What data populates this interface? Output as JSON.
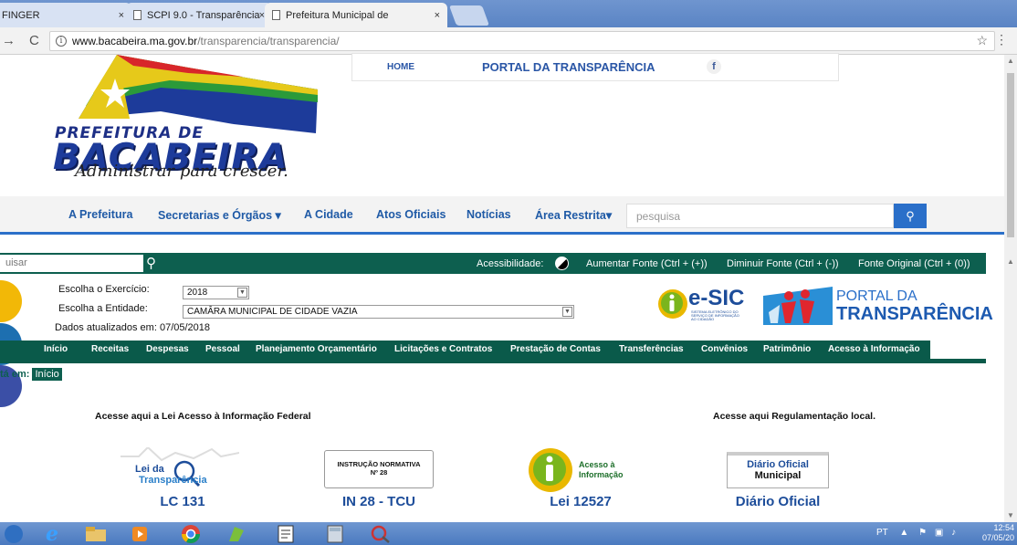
{
  "browser": {
    "tabs": [
      {
        "label": "FINGER",
        "close": "×"
      },
      {
        "label": "SCPI 9.0 - Transparência",
        "close": "×"
      },
      {
        "label": "Prefeitura Municipal de ",
        "close": "×"
      }
    ],
    "url_host": "www.bacabeira.ma.gov.br",
    "url_path": "/transparencia/transparencia/",
    "info_glyph": "i"
  },
  "header": {
    "logo_title_1": "PREFEITURA DE",
    "logo_title_2": "BACABEIRA",
    "slogan": "Administrar para crescer.",
    "top_menu": {
      "home": "HOME",
      "portal": "PORTAL DA TRANSPARÊNCIA",
      "facebook": "f"
    }
  },
  "main_nav": {
    "items": [
      "A Prefeitura",
      "Secretarias e Órgãos ▾",
      "A Cidade",
      "Atos Oficiais",
      "Notícias",
      "Área Restrita▾"
    ],
    "search_placeholder": "pesquisa"
  },
  "access_bar": {
    "search_placeholder": "uisar",
    "accessibility_label": "Acessibilidade:",
    "options": [
      "Aumentar Fonte (Ctrl + (+))",
      "Diminuir Fonte (Ctrl + (-))",
      "Fonte Original (Ctrl + (0))"
    ]
  },
  "filters": {
    "exercicio_label": "Escolha o Exercício:",
    "exercicio_value": "2018",
    "entidade_label": "Escolha a Entidade:",
    "entidade_value": "CAMÂRA MUNICIPAL DE CIDADE VAZIA",
    "updated": "Dados atualizados em: 07/05/2018"
  },
  "badges": {
    "esic": "e-SIC",
    "esic_sub": "SISTEMA ELETRÔNICO DO SERVIÇO DE INFORMAÇÃO AO CIDADÃO",
    "portal_line1": "PORTAL DA",
    "portal_line2": "TRANSPARÊNCIA"
  },
  "sub_menu": [
    "Início",
    "Receitas",
    "Despesas",
    "Pessoal",
    "Planejamento Orçamentário",
    "Licitações e Contratos",
    "Prestação de Contas",
    "Transferências",
    "Convênios",
    "Patrimônio",
    "Acesso à Informação"
  ],
  "breadcrumb": {
    "prefix": "tá em:",
    "current": "Início"
  },
  "links": {
    "federal": "Acesse aqui a Lei Acesso à Informação Federal",
    "local": "Acesse aqui Regulamentação local."
  },
  "cards": [
    {
      "logo_text_1": "Lei da",
      "logo_text_2": "Transparência",
      "title": "LC 131"
    },
    {
      "logo_text_1": "INSTRUÇÃO NORMATIVA",
      "logo_text_2": "Nº 28",
      "title": "IN 28 - TCU"
    },
    {
      "logo_text_1": "Acesso à",
      "logo_text_2": "Informação",
      "title": "Lei 12527"
    },
    {
      "logo_text_1": "Diário Oficial",
      "logo_text_2": "Municipal",
      "title": "Diário Oficial"
    }
  ],
  "taskbar": {
    "lang": "PT",
    "time": "12:54",
    "date": "07/05/20"
  },
  "colors": {
    "nav_blue": "#1f5aa6",
    "dark_green": "#0d5f4f",
    "search_blue": "#2a6fc9"
  }
}
